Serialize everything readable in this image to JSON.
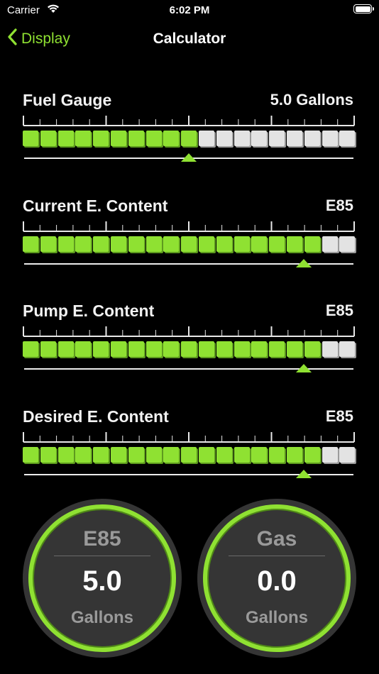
{
  "status_bar": {
    "carrier": "Carrier",
    "time": "6:02 PM",
    "wifi_icon": "wifi-icon",
    "battery_icon": "battery-icon"
  },
  "nav": {
    "back_label": "Display",
    "title": "Calculator",
    "accent_color": "#8fe132"
  },
  "gauges": [
    {
      "label": "Fuel Gauge",
      "value": "5.0 Gallons",
      "filled_blocks": 10,
      "total_blocks": 19,
      "slider_fraction": 0.5
    },
    {
      "label": "Current E. Content",
      "value": "E85",
      "filled_blocks": 17,
      "total_blocks": 19,
      "slider_fraction": 0.85
    },
    {
      "label": "Pump E. Content",
      "value": "E85",
      "filled_blocks": 17,
      "total_blocks": 19,
      "slider_fraction": 0.85
    },
    {
      "label": "Desired E. Content",
      "value": "E85",
      "filled_blocks": 17,
      "total_blocks": 19,
      "slider_fraction": 0.85
    }
  ],
  "results": [
    {
      "label": "E85",
      "value": "5.0",
      "unit": "Gallons"
    },
    {
      "label": "Gas",
      "value": "0.0",
      "unit": "Gallons"
    }
  ],
  "colors": {
    "block_on": "#8fe132",
    "block_off": "#e3e3e3",
    "ring": "#8fe132",
    "circle_bg": "#353535"
  }
}
